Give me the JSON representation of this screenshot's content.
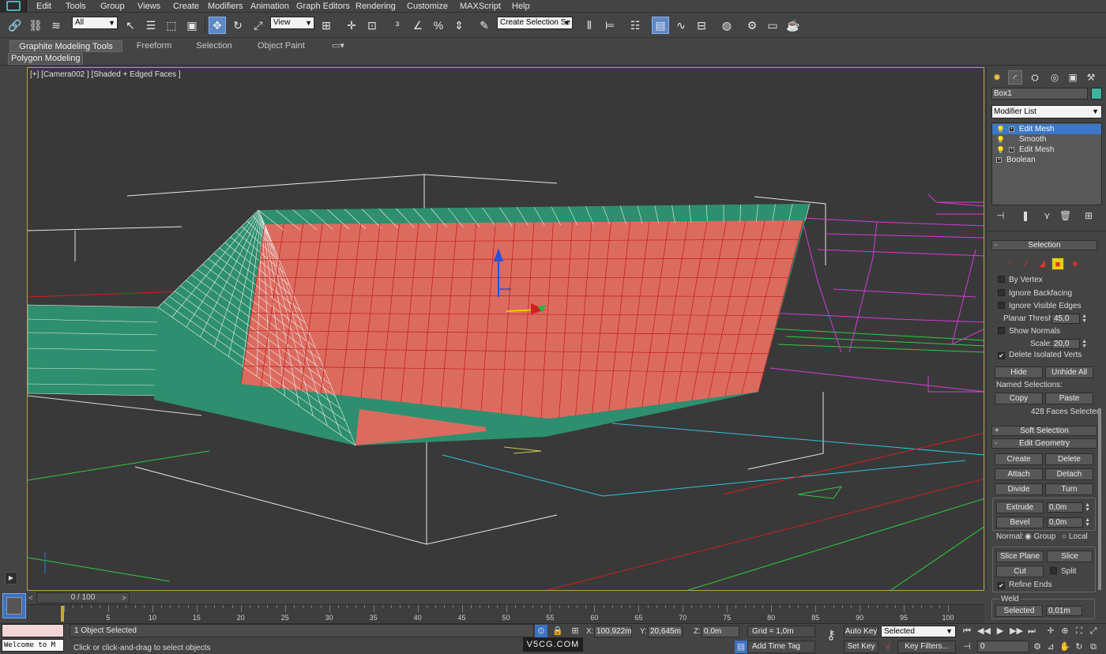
{
  "menu": [
    "Edit",
    "Tools",
    "Group",
    "Views",
    "Create",
    "Modifiers",
    "Animation",
    "Graph Editors",
    "Rendering",
    "Customize",
    "MAXScript",
    "Help"
  ],
  "toolbar": {
    "filter_value": "All",
    "coord_value": "View",
    "selection_set_placeholder": "Create Selection Se"
  },
  "ribbon": {
    "tabs": [
      "Graphite Modeling Tools",
      "Freeform",
      "Selection",
      "Object Paint"
    ],
    "active_tab": "Graphite Modeling Tools",
    "panel": "Polygon Modeling"
  },
  "viewport": {
    "label": "[+] [Camera002 ] [Shaded + Edged Faces ]"
  },
  "command_panel": {
    "object_name": "Box1",
    "object_color": "#3fb39f",
    "modifier_list": "Modifier List",
    "stack": [
      {
        "label": "Edit Mesh",
        "selected": true,
        "expandable": true
      },
      {
        "label": "Smooth",
        "selected": false,
        "expandable": false
      },
      {
        "label": "Edit Mesh",
        "selected": false,
        "expandable": true
      },
      {
        "label": "Boolean",
        "selected": false,
        "expandable": true
      }
    ],
    "selection": {
      "title": "Selection",
      "by_vertex": "By Vertex",
      "ignore_backfacing": "Ignore Backfacing",
      "ignore_visible_edges": "Ignore Visible Edges",
      "planar_thresh_label": "Planar Thresh:",
      "planar_thresh_value": "45,0",
      "show_normals": "Show Normals",
      "scale_label": "Scale:",
      "scale_value": "20,0",
      "delete_isolated": "Delete Isolated Verts",
      "delete_isolated_checked": true,
      "hide": "Hide",
      "unhide_all": "Unhide All",
      "named_selections": "Named Selections:",
      "copy": "Copy",
      "paste": "Paste",
      "faces_selected": "428 Faces Selected"
    },
    "soft_selection": "Soft Selection",
    "edit_geometry": {
      "title": "Edit Geometry",
      "create": "Create",
      "delete": "Delete",
      "attach": "Attach",
      "detach": "Detach",
      "divide": "Divide",
      "turn": "Turn",
      "extrude": "Extrude",
      "extrude_value": "0,0m",
      "bevel": "Bevel",
      "bevel_value": "0,0m",
      "normal_label": "Normal:",
      "group": "Group",
      "local": "Local",
      "slice_plane": "Slice Plane",
      "slice": "Slice",
      "cut": "Cut",
      "split": "Split",
      "refine_ends": "Refine Ends",
      "refine_ends_checked": true,
      "weld": "Weld",
      "weld_selected": "Selected",
      "weld_value": "0,01m"
    }
  },
  "timeslider": {
    "position": "0 / 100",
    "ticks": [
      5,
      10,
      15,
      20,
      25,
      30,
      35,
      40,
      45,
      50,
      55,
      60,
      65,
      70,
      75,
      80,
      85,
      90,
      95,
      100
    ]
  },
  "status": {
    "welcome": "Welcome to M",
    "objects_selected": "1 Object Selected",
    "prompt": "Click or click-and-drag to select objects",
    "x_label": "X:",
    "x_value": "100,922m",
    "y_label": "Y:",
    "y_value": "20,645m",
    "z_label": "Z:",
    "z_value": "0,0m",
    "grid": "Grid = 1,0m",
    "add_time_tag": "Add Time Tag",
    "auto_key": "Auto Key",
    "set_key": "Set Key",
    "selected": "Selected",
    "key_filters": "Key Filters...",
    "frame": "0"
  },
  "watermark": "V5CG.COM"
}
